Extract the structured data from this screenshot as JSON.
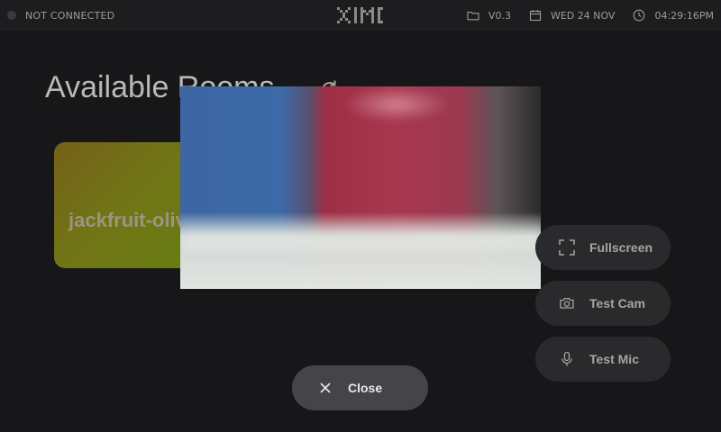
{
  "status_bar": {
    "connection": "NOT CONNECTED",
    "logo_text": "XIMI",
    "version": "V0.3",
    "date": "WED 24 NOV",
    "time": "04:29:16PM",
    "icons": [
      "folder-icon",
      "calendar-icon",
      "clock-icon"
    ]
  },
  "main": {
    "title": "Available Rooms",
    "refresh_icon": "refresh-icon"
  },
  "rooms": [
    {
      "name": "jackfruit-olive"
    }
  ],
  "preview": {
    "description_icon": "camera-preview"
  },
  "actions": {
    "fullscreen_label": "Fullscreen",
    "test_cam_label": "Test Cam",
    "test_mic_label": "Test Mic",
    "close_label": "Close"
  },
  "colors": {
    "background": "#171719",
    "topbar": "#1d1d1f",
    "button": "#2a2a2c",
    "close_button": "#454549",
    "room_card": "#7b8016"
  }
}
